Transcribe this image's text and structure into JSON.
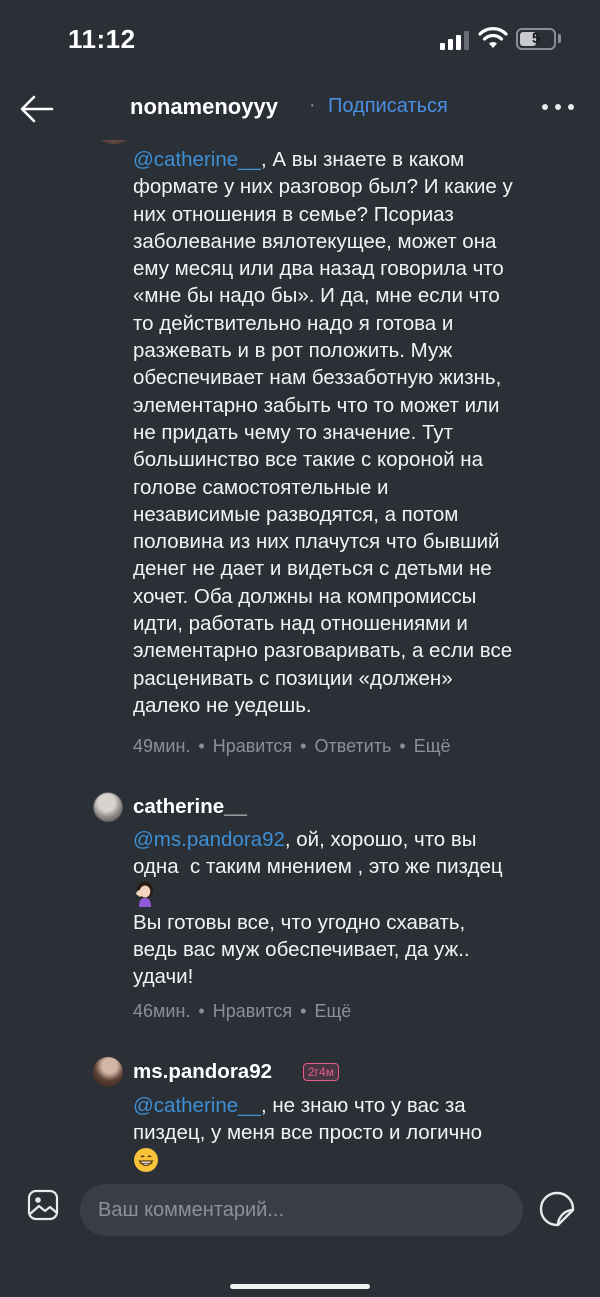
{
  "status_bar": {
    "time": "11:12",
    "battery": "5"
  },
  "header": {
    "username": "nonamenoyyy",
    "separator": "·",
    "follow_label": "Подписаться"
  },
  "comments": [
    {
      "mention": "@catherine__",
      "text_after_mention": ", А вы знаете в каком\nформате у них разговор был? И какие у\nних отношения в семье? Псориаз\nзаболевание вялотекущее, может она\nему месяц или два назад говорила что\n«мне бы надо бы». И да, мне если что\nто действительно надо я готова и\nразжевать и в рот положить. Муж\nобеспечивает нам беззаботную жизнь,\nэлементарно забыть что то может или\nне придать чему то значение. Тут\nбольшинство все такие с короной на\nголове самостоятельные и\nнезависимые разводятся, а потом\nполовина из них плачутся что бывший\nденег не дает и видеться с детьми не\nхочет. Оба должны на компромиссы\nидти, работать над отношениями и\nэлементарно разговаривать, а если все\nрасценивать с позиции «должен»\nдалеко не уедешь.",
      "time": "49мин.",
      "like_label": "Нравится",
      "reply_label": "Ответить",
      "more_label": "Ещё"
    },
    {
      "username": "catherine__",
      "mention": "@ms.pandora92",
      "text_line1": ", ой, хорошо, что вы",
      "text_line2": "одна  с таким мнением , это же пиздец",
      "emoji": "woman-facepalming-emoji",
      "text_after_emoji": "Вы готовы все, что угодно схавать,\nведь вас муж обеспечивает, да уж..\nудачи!",
      "time": "46мин.",
      "like_label": "Нравится",
      "more_label": "Ещё"
    },
    {
      "username": "ms.pandora92",
      "badge": "2г4м",
      "mention": "@catherine__",
      "text_after_mention": ", не знаю что у вас за\nпиздец, у меня все просто и логично",
      "emoji": "grinning-face-emoji"
    }
  ],
  "input": {
    "placeholder": "Ваш комментарий..."
  },
  "colors": {
    "background": "#2b2f36",
    "accent": "#4a90e2",
    "mention": "#3d8fd6",
    "muted": "#8c9097",
    "badge": "#e55c8f"
  }
}
